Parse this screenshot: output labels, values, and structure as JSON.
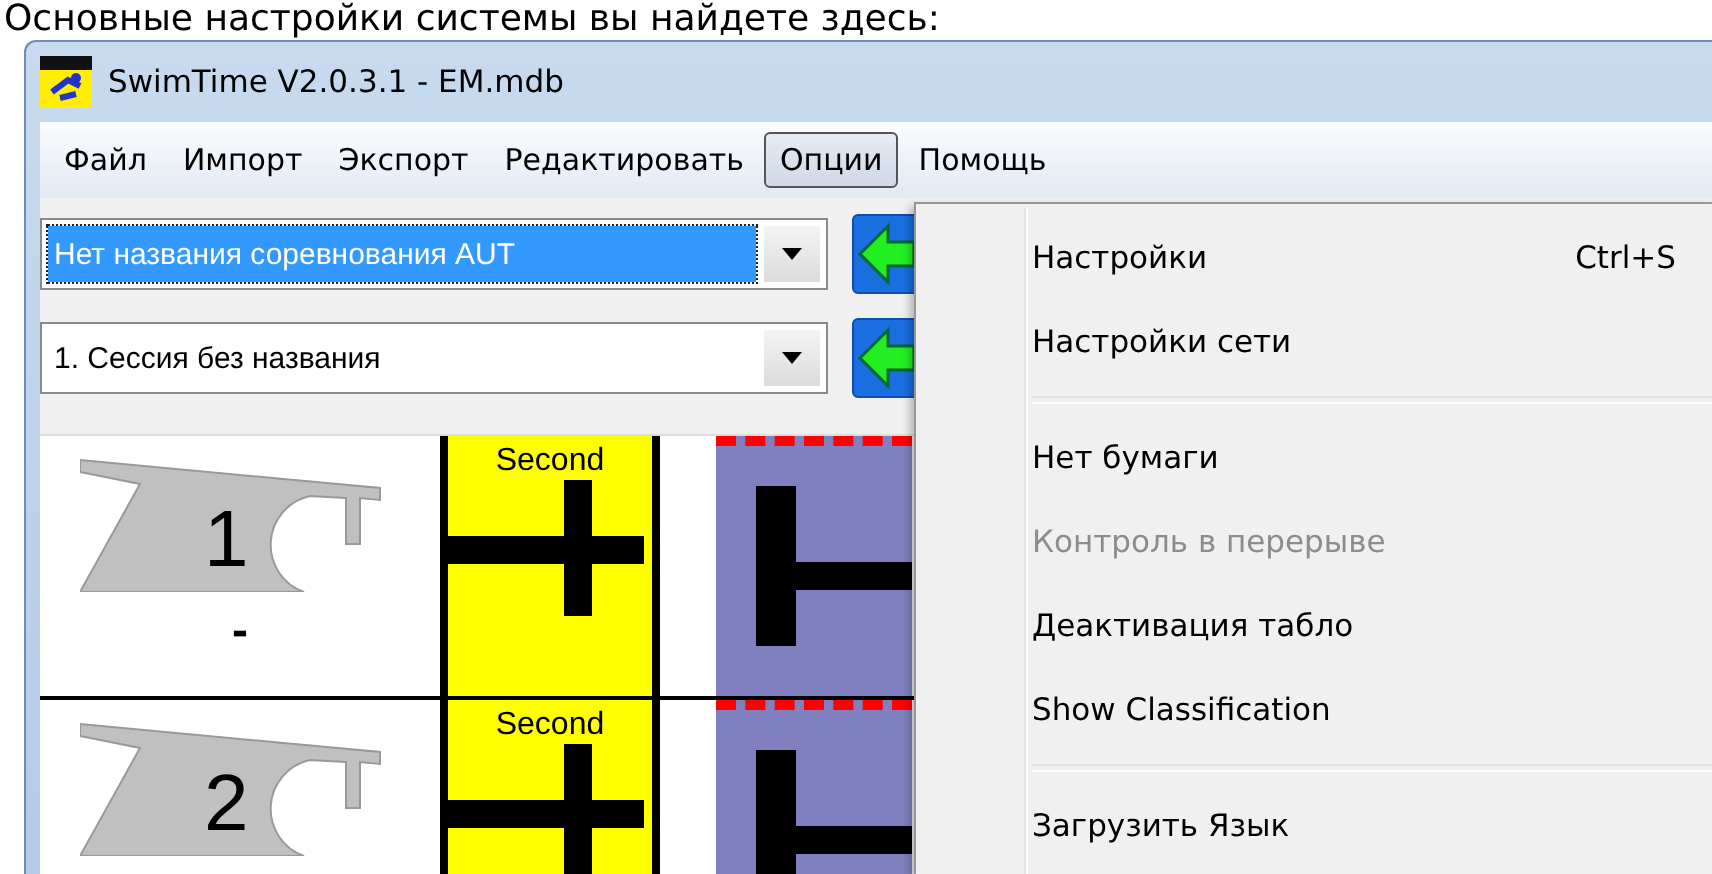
{
  "caption": "Основные настройки системы вы найдете здесь:",
  "window": {
    "title": "SwimTime V2.0.3.1 - EM.mdb"
  },
  "menu": [
    {
      "label": "Файл",
      "selected": false
    },
    {
      "label": "Импорт",
      "selected": false
    },
    {
      "label": "Экспорт",
      "selected": false
    },
    {
      "label": "Редактировать",
      "selected": false
    },
    {
      "label": "Опции",
      "selected": true
    },
    {
      "label": "Помощь",
      "selected": false
    }
  ],
  "selectors": [
    {
      "value": "Нет названия соревнования AUT",
      "selected": true
    },
    {
      "value": "1. Сессия без названия",
      "selected": false
    }
  ],
  "lanes": [
    {
      "number": "1",
      "status": "-",
      "label": "Second"
    },
    {
      "number": "2",
      "label": "Second"
    }
  ],
  "dropdown": [
    {
      "kind": "item",
      "label": "Настройки",
      "shortcut": "Ctrl+S",
      "disabled": false
    },
    {
      "kind": "item",
      "label": "Настройки сети",
      "disabled": false
    },
    {
      "kind": "separator"
    },
    {
      "kind": "item",
      "label": "Нет бумаги",
      "disabled": false
    },
    {
      "kind": "item",
      "label": "Контроль в перерыве",
      "disabled": true
    },
    {
      "kind": "item",
      "label": "Деактивация табло",
      "disabled": false
    },
    {
      "kind": "item",
      "label": "Show Classification",
      "disabled": false
    },
    {
      "kind": "separator"
    },
    {
      "kind": "item",
      "label": "Загрузить Язык",
      "disabled": false
    }
  ]
}
